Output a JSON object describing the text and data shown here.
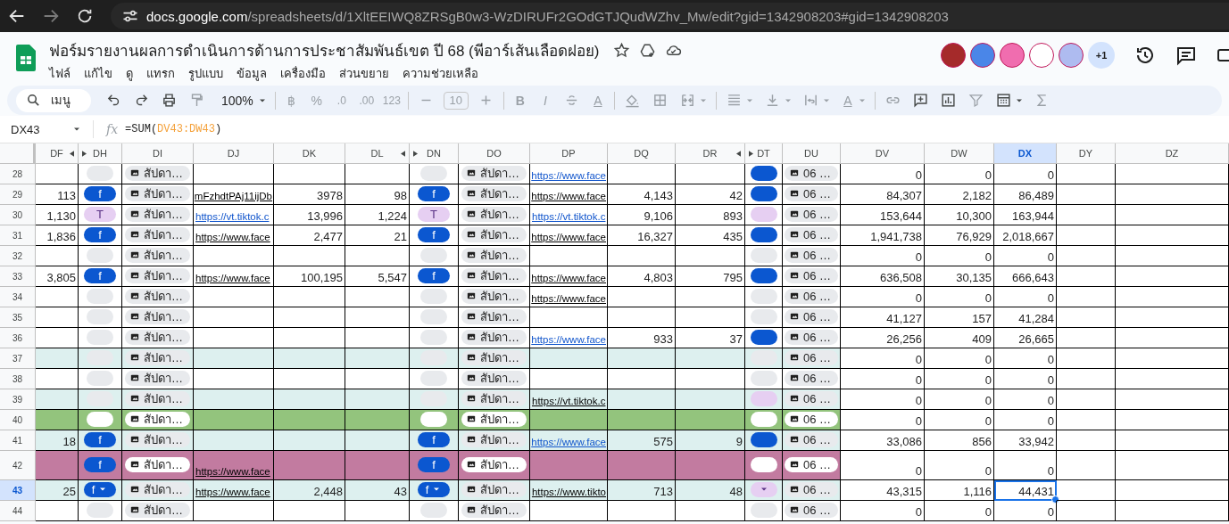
{
  "browser": {
    "url": "docs.google.com/spreadsheets/d/1XltEEIWQ8ZRSgB0w3-WzDIRUFr2GOdGTJQudWZhv_Mw/edit?gid=1342908203#gid=1342908203"
  },
  "document": {
    "title": "ฟอร์มรายงานผลการดำเนินการด้านการประชาสัมพันธ์เขต ปี 68 (พีอาร์เส้นเลือดฝอย)"
  },
  "menu": [
    "ไฟล์",
    "แก้ไข",
    "ดู",
    "แทรก",
    "รูปแบบ",
    "ข้อมูล",
    "เครื่องมือ",
    "ส่วนขยาย",
    "ความช่วยเหลือ"
  ],
  "collaborators": [
    {
      "color": "#a52a2a"
    },
    {
      "color": "#4a86e8"
    },
    {
      "color": "#f06daf"
    },
    {
      "color": "#ffffff"
    },
    {
      "color": "#aebbf0"
    }
  ],
  "more_collaborators": "+1",
  "toolbar": {
    "search_placeholder": "เมนู",
    "zoom": "100%",
    "currency": "฿",
    "percent": "%",
    "decrease_decimal": ".0",
    "increase_decimal": ".00",
    "number_format": "123",
    "font_size": "10",
    "bold": "B",
    "italic": "I",
    "text_color": "A",
    "text_rotation": "A"
  },
  "formula_bar": {
    "cell": "DX43",
    "fx": "fx",
    "formula": "=SUM(DV43:DW43)"
  },
  "columns": [
    {
      "label": "DF",
      "selected": false,
      "hidden_before": false,
      "hidden_after": true
    },
    {
      "label": "DH",
      "selected": false,
      "hidden_before": true,
      "hidden_after": false
    },
    {
      "label": "DI",
      "selected": false,
      "hidden_before": false,
      "hidden_after": false
    },
    {
      "label": "DJ",
      "selected": false,
      "hidden_before": false,
      "hidden_after": false
    },
    {
      "label": "DK",
      "selected": false,
      "hidden_before": false,
      "hidden_after": false
    },
    {
      "label": "DL",
      "selected": false,
      "hidden_before": false,
      "hidden_after": true
    },
    {
      "label": "DN",
      "selected": false,
      "hidden_before": true,
      "hidden_after": false
    },
    {
      "label": "DO",
      "selected": false,
      "hidden_before": false,
      "hidden_after": false
    },
    {
      "label": "DP",
      "selected": false,
      "hidden_before": false,
      "hidden_after": false
    },
    {
      "label": "DQ",
      "selected": false,
      "hidden_before": false,
      "hidden_after": false
    },
    {
      "label": "DR",
      "selected": false,
      "hidden_before": false,
      "hidden_after": true
    },
    {
      "label": "DT",
      "selected": false,
      "hidden_before": true,
      "hidden_after": false
    },
    {
      "label": "DU",
      "selected": false,
      "hidden_before": false,
      "hidden_after": false
    },
    {
      "label": "DV",
      "selected": false,
      "hidden_before": false,
      "hidden_after": false
    },
    {
      "label": "DW",
      "selected": false,
      "hidden_before": false,
      "hidden_after": false
    },
    {
      "label": "DX",
      "selected": true,
      "hidden_before": false,
      "hidden_after": false
    },
    {
      "label": "DY",
      "selected": false,
      "hidden_before": false,
      "hidden_after": false
    },
    {
      "label": "DZ",
      "selected": false,
      "hidden_before": false,
      "hidden_after": false
    }
  ],
  "rows": [
    {
      "num": "28",
      "selected": false,
      "cells": [
        null,
        {
          "kind": "empty_chip"
        },
        {
          "kind": "file",
          "text": "สัปดา…"
        },
        null,
        null,
        null,
        {
          "kind": "empty_chip"
        },
        {
          "kind": "file",
          "text": "สัปดา…"
        },
        {
          "kind": "link",
          "text": "https://www.face",
          "linked": true
        },
        null,
        null,
        {
          "kind": "facebook_chip"
        },
        {
          "kind": "file",
          "text": "06 …"
        },
        "0",
        "0",
        "0"
      ]
    },
    {
      "num": "29",
      "selected": false,
      "cells": [
        "113",
        {
          "kind": "facebook_chip",
          "label": "f"
        },
        {
          "kind": "file",
          "text": "สัปดา…"
        },
        {
          "kind": "link",
          "text": "mFzhdtPAj11ijDb",
          "linked": false
        },
        "3978",
        "98",
        {
          "kind": "facebook_chip",
          "label": "f"
        },
        {
          "kind": "file",
          "text": "สัปดา…"
        },
        {
          "kind": "link",
          "text": "https://www.face",
          "linked": false
        },
        "4,143",
        "42",
        {
          "kind": "facebook_chip"
        },
        {
          "kind": "file",
          "text": "06 …"
        },
        "84,307",
        "2,182",
        "86,489"
      ]
    },
    {
      "num": "30",
      "selected": false,
      "cells": [
        "1,130",
        {
          "kind": "tiktok_chip",
          "label": "T"
        },
        {
          "kind": "file",
          "text": "สัปดา…"
        },
        {
          "kind": "link",
          "text": "https://vt.tiktok.c",
          "linked": true
        },
        "13,996",
        "1,224",
        {
          "kind": "tiktok_chip",
          "label": "T"
        },
        {
          "kind": "file",
          "text": "สัปดา…"
        },
        {
          "kind": "link",
          "text": "https://vt.tiktok.c",
          "linked": true
        },
        "9,106",
        "893",
        {
          "kind": "tiktok_chip"
        },
        {
          "kind": "file",
          "text": "06 …"
        },
        "153,644",
        "10,300",
        "163,944"
      ]
    },
    {
      "num": "31",
      "selected": false,
      "cells": [
        "1,836",
        {
          "kind": "facebook_chip",
          "label": "f"
        },
        {
          "kind": "file",
          "text": "สัปดา…"
        },
        {
          "kind": "link",
          "text": "https://www.face",
          "linked": false
        },
        "2,477",
        "21",
        {
          "kind": "facebook_chip",
          "label": "f"
        },
        {
          "kind": "file",
          "text": "สัปดา…"
        },
        {
          "kind": "link",
          "text": "https://www.face",
          "linked": false
        },
        "16,327",
        "435",
        {
          "kind": "facebook_chip"
        },
        {
          "kind": "file",
          "text": "06 …"
        },
        "1,941,738",
        "76,929",
        "2,018,667"
      ]
    },
    {
      "num": "32",
      "selected": false,
      "cells": [
        null,
        {
          "kind": "empty_chip"
        },
        {
          "kind": "file",
          "text": "สัปดา…"
        },
        null,
        null,
        null,
        {
          "kind": "empty_chip"
        },
        {
          "kind": "file",
          "text": "สัปดา…"
        },
        null,
        null,
        null,
        {
          "kind": "empty_chip"
        },
        {
          "kind": "file",
          "text": "06 …"
        },
        "0",
        "0",
        "0"
      ]
    },
    {
      "num": "33",
      "selected": false,
      "cells": [
        "3,805",
        {
          "kind": "facebook_chip",
          "label": "f"
        },
        {
          "kind": "file",
          "text": "สัปดา…"
        },
        {
          "kind": "link",
          "text": "https://www.face",
          "linked": false
        },
        "100,195",
        "5,547",
        {
          "kind": "facebook_chip",
          "label": "f"
        },
        {
          "kind": "file",
          "text": "สัปดา…"
        },
        {
          "kind": "link",
          "text": "https://www.face",
          "linked": false
        },
        "4,803",
        "795",
        {
          "kind": "facebook_chip"
        },
        {
          "kind": "file",
          "text": "06 …"
        },
        "636,508",
        "30,135",
        "666,643"
      ]
    },
    {
      "num": "34",
      "selected": false,
      "cells": [
        null,
        {
          "kind": "empty_chip"
        },
        {
          "kind": "file",
          "text": "สัปดา…"
        },
        null,
        null,
        null,
        {
          "kind": "empty_chip"
        },
        {
          "kind": "file",
          "text": "สัปดา…"
        },
        {
          "kind": "link",
          "text": "https://www.face",
          "linked": false
        },
        null,
        null,
        {
          "kind": "empty_chip"
        },
        {
          "kind": "file",
          "text": "06 …"
        },
        "0",
        "0",
        "0"
      ]
    },
    {
      "num": "35",
      "selected": false,
      "cells": [
        null,
        {
          "kind": "empty_chip"
        },
        {
          "kind": "file",
          "text": "สัปดา…"
        },
        null,
        null,
        null,
        {
          "kind": "empty_chip"
        },
        {
          "kind": "file",
          "text": "สัปดา…"
        },
        null,
        null,
        null,
        {
          "kind": "empty_chip"
        },
        {
          "kind": "file",
          "text": "06 …"
        },
        "41,127",
        "157",
        "41,284"
      ]
    },
    {
      "num": "36",
      "selected": false,
      "cells": [
        null,
        {
          "kind": "empty_chip"
        },
        {
          "kind": "file",
          "text": "สัปดา…"
        },
        null,
        null,
        null,
        {
          "kind": "empty_chip"
        },
        {
          "kind": "file",
          "text": "สัปดา…"
        },
        {
          "kind": "link",
          "text": "https://www.face",
          "linked": true
        },
        "933",
        "37",
        {
          "kind": "facebook_chip"
        },
        {
          "kind": "file",
          "text": "06 …"
        },
        "26,256",
        "409",
        "26,665"
      ]
    },
    {
      "num": "37",
      "color": "#ddf0ef",
      "selected": false,
      "cells": [
        null,
        {
          "kind": "empty_chip"
        },
        {
          "kind": "file",
          "text": "สัปดา…"
        },
        null,
        null,
        null,
        {
          "kind": "empty_chip"
        },
        {
          "kind": "file",
          "text": "สัปดา…"
        },
        null,
        null,
        null,
        {
          "kind": "empty_chip"
        },
        {
          "kind": "file",
          "text": "06 …"
        },
        "0",
        "0",
        "0"
      ]
    },
    {
      "num": "38",
      "selected": false,
      "cells": [
        null,
        {
          "kind": "empty_chip"
        },
        {
          "kind": "file",
          "text": "สัปดา…"
        },
        null,
        null,
        null,
        {
          "kind": "empty_chip"
        },
        {
          "kind": "file",
          "text": "สัปดา…"
        },
        null,
        null,
        null,
        {
          "kind": "empty_chip"
        },
        {
          "kind": "file",
          "text": "06 …"
        },
        "0",
        "0",
        "0"
      ]
    },
    {
      "num": "39",
      "color": "#ddf0ef",
      "selected": false,
      "cells": [
        null,
        {
          "kind": "empty_chip"
        },
        {
          "kind": "file",
          "text": "สัปดา…"
        },
        null,
        null,
        null,
        {
          "kind": "empty_chip"
        },
        {
          "kind": "file",
          "text": "สัปดา…"
        },
        {
          "kind": "link",
          "text": "https://vt.tiktok.c",
          "linked": false
        },
        null,
        null,
        {
          "kind": "tiktok_chip"
        },
        {
          "kind": "file",
          "text": "06 …"
        },
        "0",
        "0",
        "0"
      ]
    },
    {
      "num": "40",
      "color": "#93c47d",
      "selected": false,
      "cells": [
        null,
        {
          "kind": "empty_chip"
        },
        {
          "kind": "file",
          "text": "สัปดา…"
        },
        null,
        null,
        null,
        {
          "kind": "empty_chip"
        },
        {
          "kind": "file",
          "text": "สัปดา…"
        },
        null,
        null,
        null,
        {
          "kind": "empty_chip"
        },
        {
          "kind": "file",
          "text": "06 …"
        },
        "0",
        "0",
        "0"
      ]
    },
    {
      "num": "41",
      "color": "#ddf0ef",
      "selected": false,
      "cells": [
        "18",
        {
          "kind": "facebook_chip",
          "label": "f"
        },
        {
          "kind": "file",
          "text": "สัปดา…"
        },
        null,
        null,
        null,
        {
          "kind": "facebook_chip",
          "label": "f"
        },
        {
          "kind": "file",
          "text": "สัปดา…"
        },
        {
          "kind": "link",
          "text": "https://www.face",
          "linked": true
        },
        "575",
        "9",
        {
          "kind": "facebook_chip"
        },
        {
          "kind": "file",
          "text": "06 …"
        },
        "33,086",
        "856",
        "33,942"
      ]
    },
    {
      "num": "42",
      "color": "#c27ba0",
      "selected": false,
      "cells": [
        null,
        {
          "kind": "facebook_chip",
          "label": "f"
        },
        {
          "kind": "file",
          "text": "สัปดา…"
        },
        {
          "kind": "link",
          "text": "https://www.face",
          "linked": false
        },
        null,
        null,
        {
          "kind": "facebook_chip",
          "label": "f"
        },
        {
          "kind": "file",
          "text": "สัปดา…"
        },
        null,
        null,
        null,
        {
          "kind": "empty_chip"
        },
        {
          "kind": "file",
          "text": "06 …"
        },
        "0",
        "0",
        "0"
      ]
    },
    {
      "num": "43",
      "color": "#ddf0ef",
      "selected": true,
      "cells": [
        "25",
        {
          "kind": "facebook_chip",
          "label": "f"
        },
        {
          "kind": "file",
          "text": "สัปดา…"
        },
        {
          "kind": "link",
          "text": "https://www.face",
          "linked": false
        },
        "2,448",
        "43",
        {
          "kind": "facebook_chip",
          "label": "f"
        },
        {
          "kind": "file",
          "text": "สัปดา…"
        },
        {
          "kind": "link",
          "text": "https://www.tikto",
          "linked": false
        },
        "713",
        "48",
        {
          "kind": "tiktok_chip"
        },
        {
          "kind": "file",
          "text": "06 …"
        },
        "43,315",
        "1,116",
        "44,431"
      ]
    },
    {
      "num": "44",
      "selected": false,
      "cells": [
        null,
        {
          "kind": "empty_chip"
        },
        {
          "kind": "file",
          "text": "สัปดา…"
        },
        null,
        null,
        null,
        {
          "kind": "empty_chip"
        },
        {
          "kind": "file",
          "text": "สัปดา…"
        },
        null,
        null,
        null,
        {
          "kind": "empty_chip"
        },
        {
          "kind": "file",
          "text": "06 …"
        },
        "0",
        "0",
        "0"
      ]
    }
  ]
}
